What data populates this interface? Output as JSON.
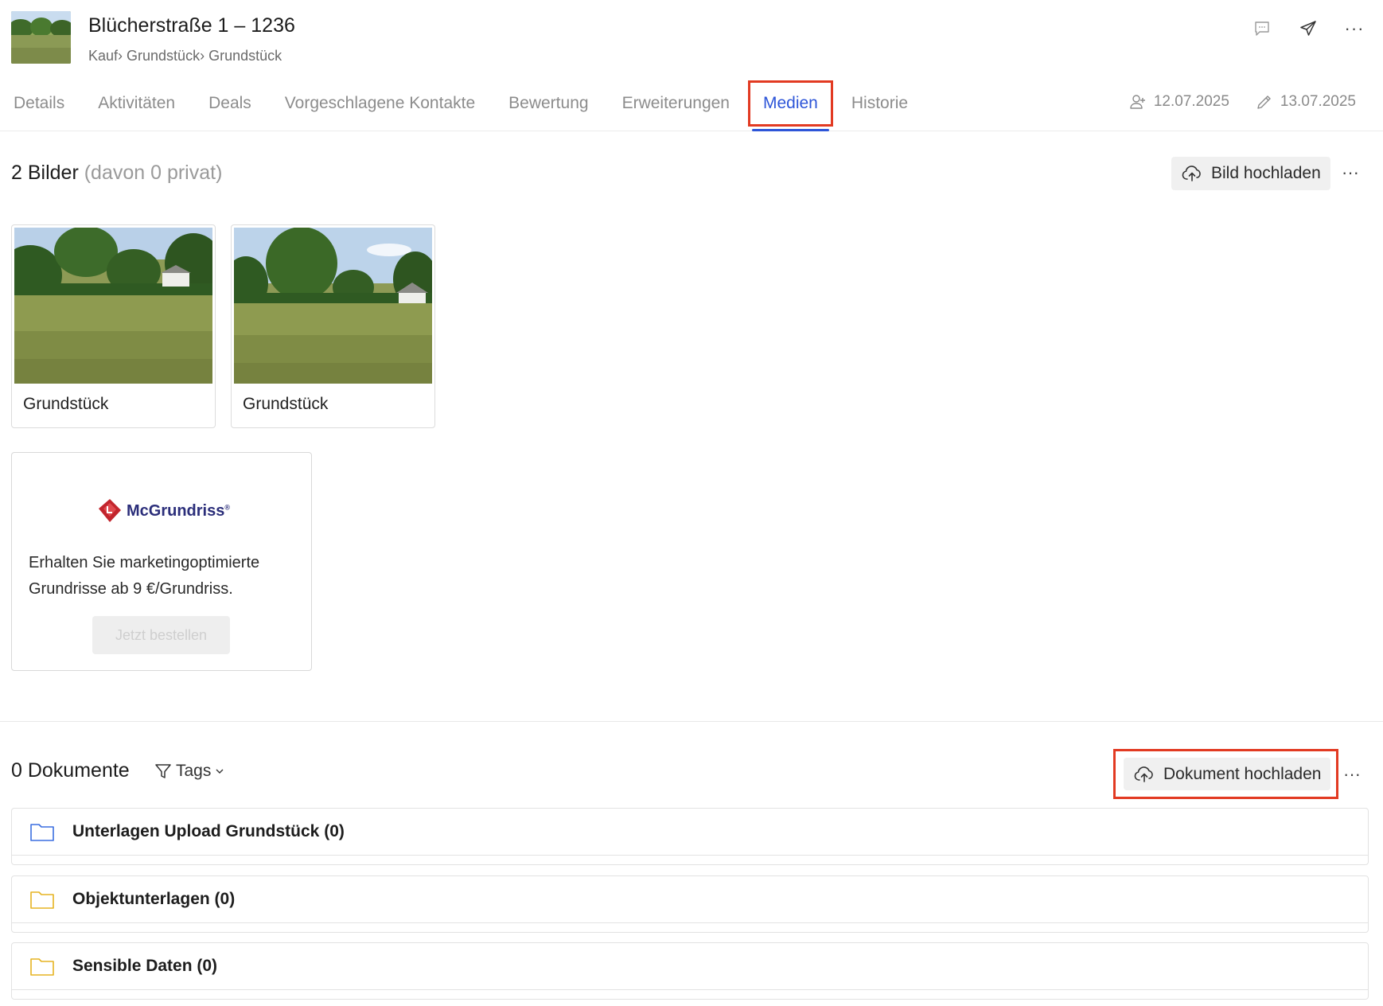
{
  "header": {
    "title": "Blücherstraße 1 – 1236",
    "breadcrumb": [
      "Kauf",
      "Grundstück",
      "Grundstück"
    ],
    "icons": [
      "comment-icon",
      "send-icon",
      "more-icon"
    ],
    "more_label": "···"
  },
  "tabs": [
    {
      "label": "Details",
      "active": false
    },
    {
      "label": "Aktivitäten",
      "active": false
    },
    {
      "label": "Deals",
      "active": false
    },
    {
      "label": "Vorgeschlagene Kontakte",
      "active": false
    },
    {
      "label": "Bewertung",
      "active": false
    },
    {
      "label": "Erweiterungen",
      "active": false
    },
    {
      "label": "Medien",
      "active": true
    },
    {
      "label": "Historie",
      "active": false
    }
  ],
  "meta": {
    "created": "12.07.2025",
    "edited": "13.07.2025"
  },
  "images": {
    "heading": "2 Bilder",
    "subheading": "(davon 0 privat)",
    "upload_label": "Bild hochladen",
    "more_label": "···",
    "items": [
      {
        "caption": "Grundstück"
      },
      {
        "caption": "Grundstück"
      }
    ]
  },
  "promo": {
    "brand": "McGrundriss",
    "brand_mark": "®",
    "text": "Erhalten Sie marketingoptimierte Grundrisse ab 9 €/Grundriss.",
    "cta": "Jetzt bestellen"
  },
  "documents": {
    "heading": "0 Dokumente",
    "filter_label": "Tags",
    "upload_label": "Dokument hochladen",
    "more_label": "···",
    "folders": [
      {
        "label": "Unterlagen Upload Grundstück (0)",
        "color": "#3b6fe0"
      },
      {
        "label": "Objektunterlagen (0)",
        "color": "#e6b422"
      },
      {
        "label": "Sensible Daten (0)",
        "color": "#e6b422"
      }
    ]
  },
  "colors": {
    "accent": "#2d55d8",
    "highlight": "#e23a22"
  }
}
